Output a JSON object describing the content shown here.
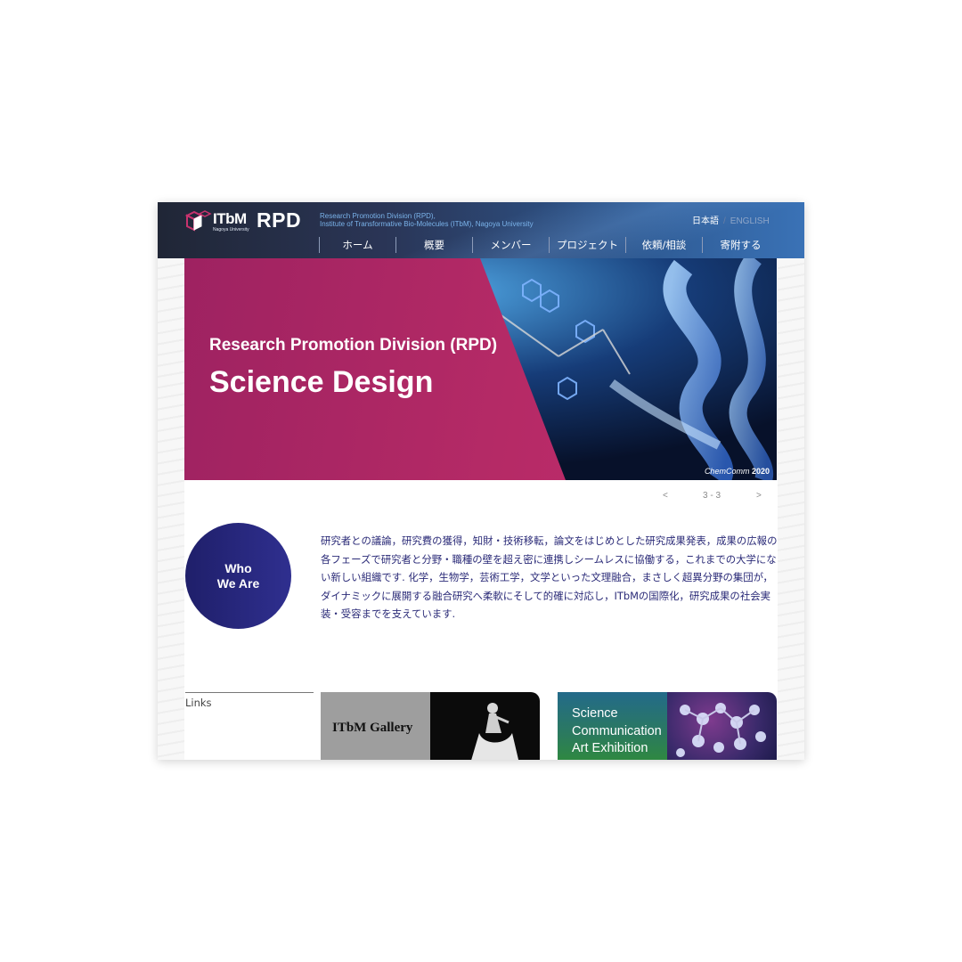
{
  "header": {
    "logo_text": "ITbM",
    "logo_sub": "Nagoya University",
    "rpd": "RPD",
    "subtitle_line1": "Research Promotion Division (RPD),",
    "subtitle_line2": "Institute of Transformative Bio-Molecules (ITbM), Nagoya University",
    "lang_jp": "日本語",
    "lang_sep": "/",
    "lang_en": "ENGLISH",
    "nav": [
      "ホーム",
      "概要",
      "メンバー",
      "プロジェクト",
      "依頼/相談",
      "寄附する"
    ]
  },
  "hero": {
    "small_title": "Research Promotion Division (RPD)",
    "big_title": "Science Design",
    "credit_italic": "ChemComm",
    "credit_year": "2020"
  },
  "slider": {
    "prev": "<",
    "count": "3 - 3",
    "next": ">"
  },
  "who": {
    "line1": "Who",
    "line2": "We Are",
    "text": "研究者との議論，研究費の獲得，知財・技術移転，論文をはじめとした研究成果発表，成果の広報の各フェーズで研究者と分野・職種の壁を超え密に連携しシームレスに協働する，これまでの大学にない新しい組織です. 化学，生物学，芸術工学，文学といった文理融合，まさしく超異分野の集団が，ダイナミックに展開する融合研究へ柔軟にそして的確に対応し，ITbMの国際化，研究成果の社会実装・受容までを支えています."
  },
  "links": {
    "label": "Links",
    "gallery": "ITbM Gallery",
    "sci_line1": "Science",
    "sci_line2": "Communication",
    "sci_line3": "Art Exhibition"
  },
  "colors": {
    "header_dark": "#202636",
    "header_blue": "#3a72b6",
    "hero_pink": "#b52a66",
    "who_circle": "#2a2a85",
    "body_text": "#2b2b78"
  }
}
